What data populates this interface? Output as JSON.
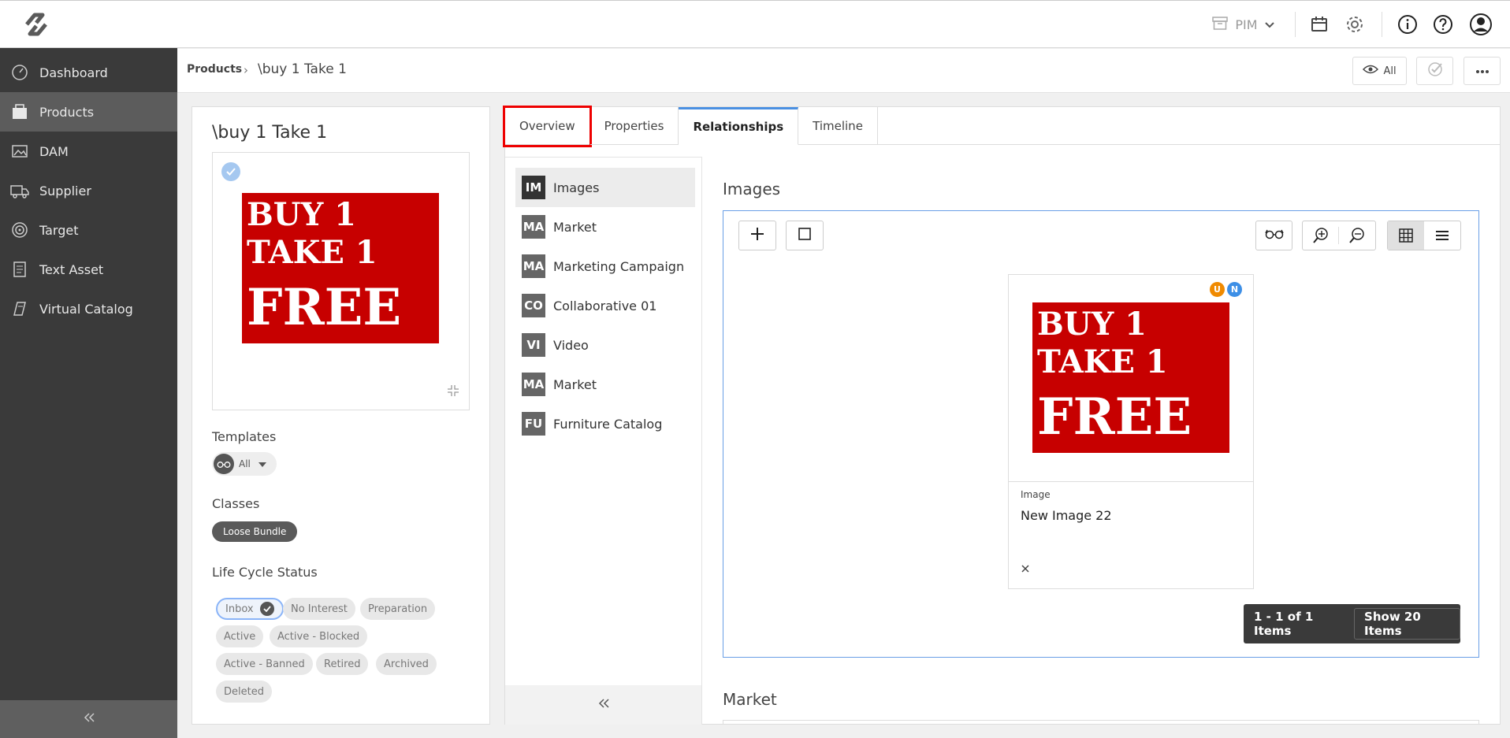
{
  "topbar": {
    "module_selector": "PIM",
    "icons": [
      "logo-icon",
      "box-icon",
      "chevron-down-icon",
      "calendar-icon",
      "gear-icon",
      "info-icon",
      "help-icon",
      "user-icon"
    ]
  },
  "sidebar": {
    "items": [
      {
        "label": "Dashboard",
        "icon": "dashboard-icon"
      },
      {
        "label": "Products",
        "icon": "products-icon",
        "active": true
      },
      {
        "label": "DAM",
        "icon": "image-icon"
      },
      {
        "label": "Supplier",
        "icon": "truck-icon"
      },
      {
        "label": "Target",
        "icon": "target-icon"
      },
      {
        "label": "Text Asset",
        "icon": "document-icon"
      },
      {
        "label": "Virtual Catalog",
        "icon": "catalog-icon"
      }
    ]
  },
  "subheader": {
    "breadcrumb_root": "Products",
    "breadcrumb_separator": "›",
    "breadcrumb_current": "\\buy 1 Take 1",
    "view_filter_label": "All"
  },
  "product": {
    "title": "\\buy 1 Take 1",
    "image_text": {
      "line1": "BUY 1",
      "line2": "TAKE 1",
      "line3": "FREE"
    },
    "templates_label": "Templates",
    "templates_value": "All",
    "classes_label": "Classes",
    "class_chip": "Loose Bundle",
    "lifecycle_label": "Life Cycle Status",
    "lifecycle": [
      "Inbox",
      "No Interest",
      "Preparation",
      "Active",
      "Active - Blocked",
      "Active - Banned",
      "Retired",
      "Archived",
      "Deleted"
    ],
    "lifecycle_selected": "Inbox"
  },
  "tabs": [
    "Overview",
    "Properties",
    "Relationships",
    "Timeline"
  ],
  "active_tab": "Relationships",
  "relationships": [
    {
      "abbr": "IM",
      "label": "Images",
      "active": true
    },
    {
      "abbr": "MA",
      "label": "Market"
    },
    {
      "abbr": "MA",
      "label": "Marketing Campaign"
    },
    {
      "abbr": "CO",
      "label": "Collaborative 01"
    },
    {
      "abbr": "VI",
      "label": "Video"
    },
    {
      "abbr": "MA",
      "label": "Market"
    },
    {
      "abbr": "FU",
      "label": "Furniture Catalog"
    }
  ],
  "images_section": {
    "heading": "Images",
    "card": {
      "type": "Image",
      "name": "New Image 22",
      "badges": [
        {
          "letter": "U",
          "color": "#f08a00"
        },
        {
          "letter": "N",
          "color": "#3d8fe6"
        }
      ]
    },
    "pager_info": "1 - 1 of 1 Items",
    "pager_button": "Show 20 Items"
  },
  "market_section": {
    "heading": "Market"
  },
  "colors": {
    "sidebar": "#3a3a3a",
    "accent": "#4a90e2",
    "promo_red": "#c70000",
    "highlight": "#ee0000"
  }
}
